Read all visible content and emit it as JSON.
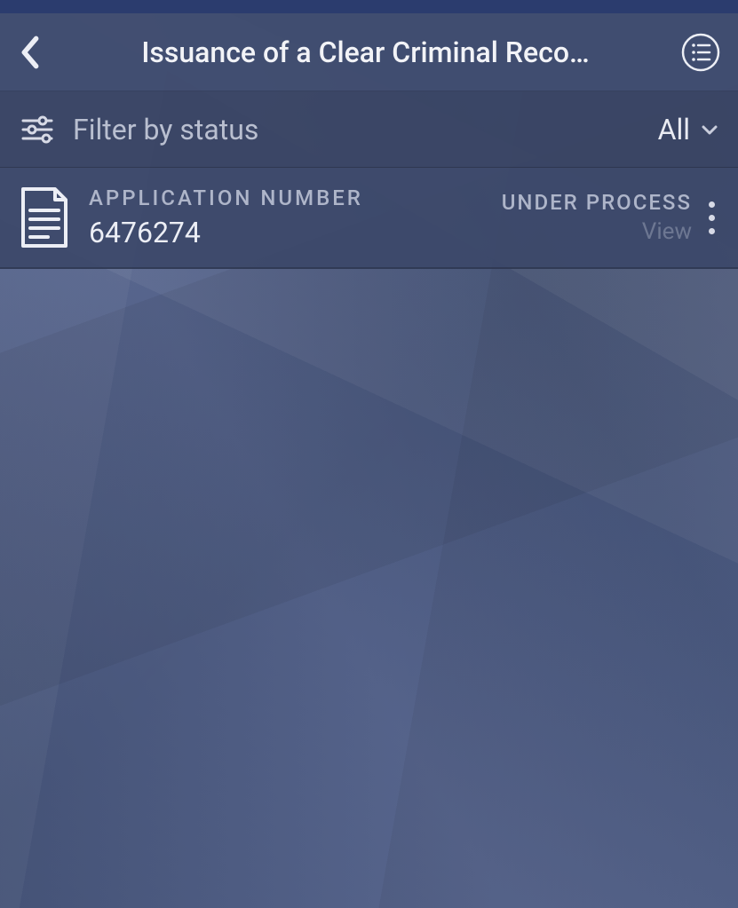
{
  "header": {
    "title": "Issuance of a Clear Criminal Reco…"
  },
  "filter": {
    "label": "Filter by status",
    "value": "All"
  },
  "list": {
    "items": [
      {
        "label": "APPLICATION NUMBER",
        "number": "6476274",
        "status": "UNDER PROCESS",
        "action": "View"
      }
    ]
  }
}
